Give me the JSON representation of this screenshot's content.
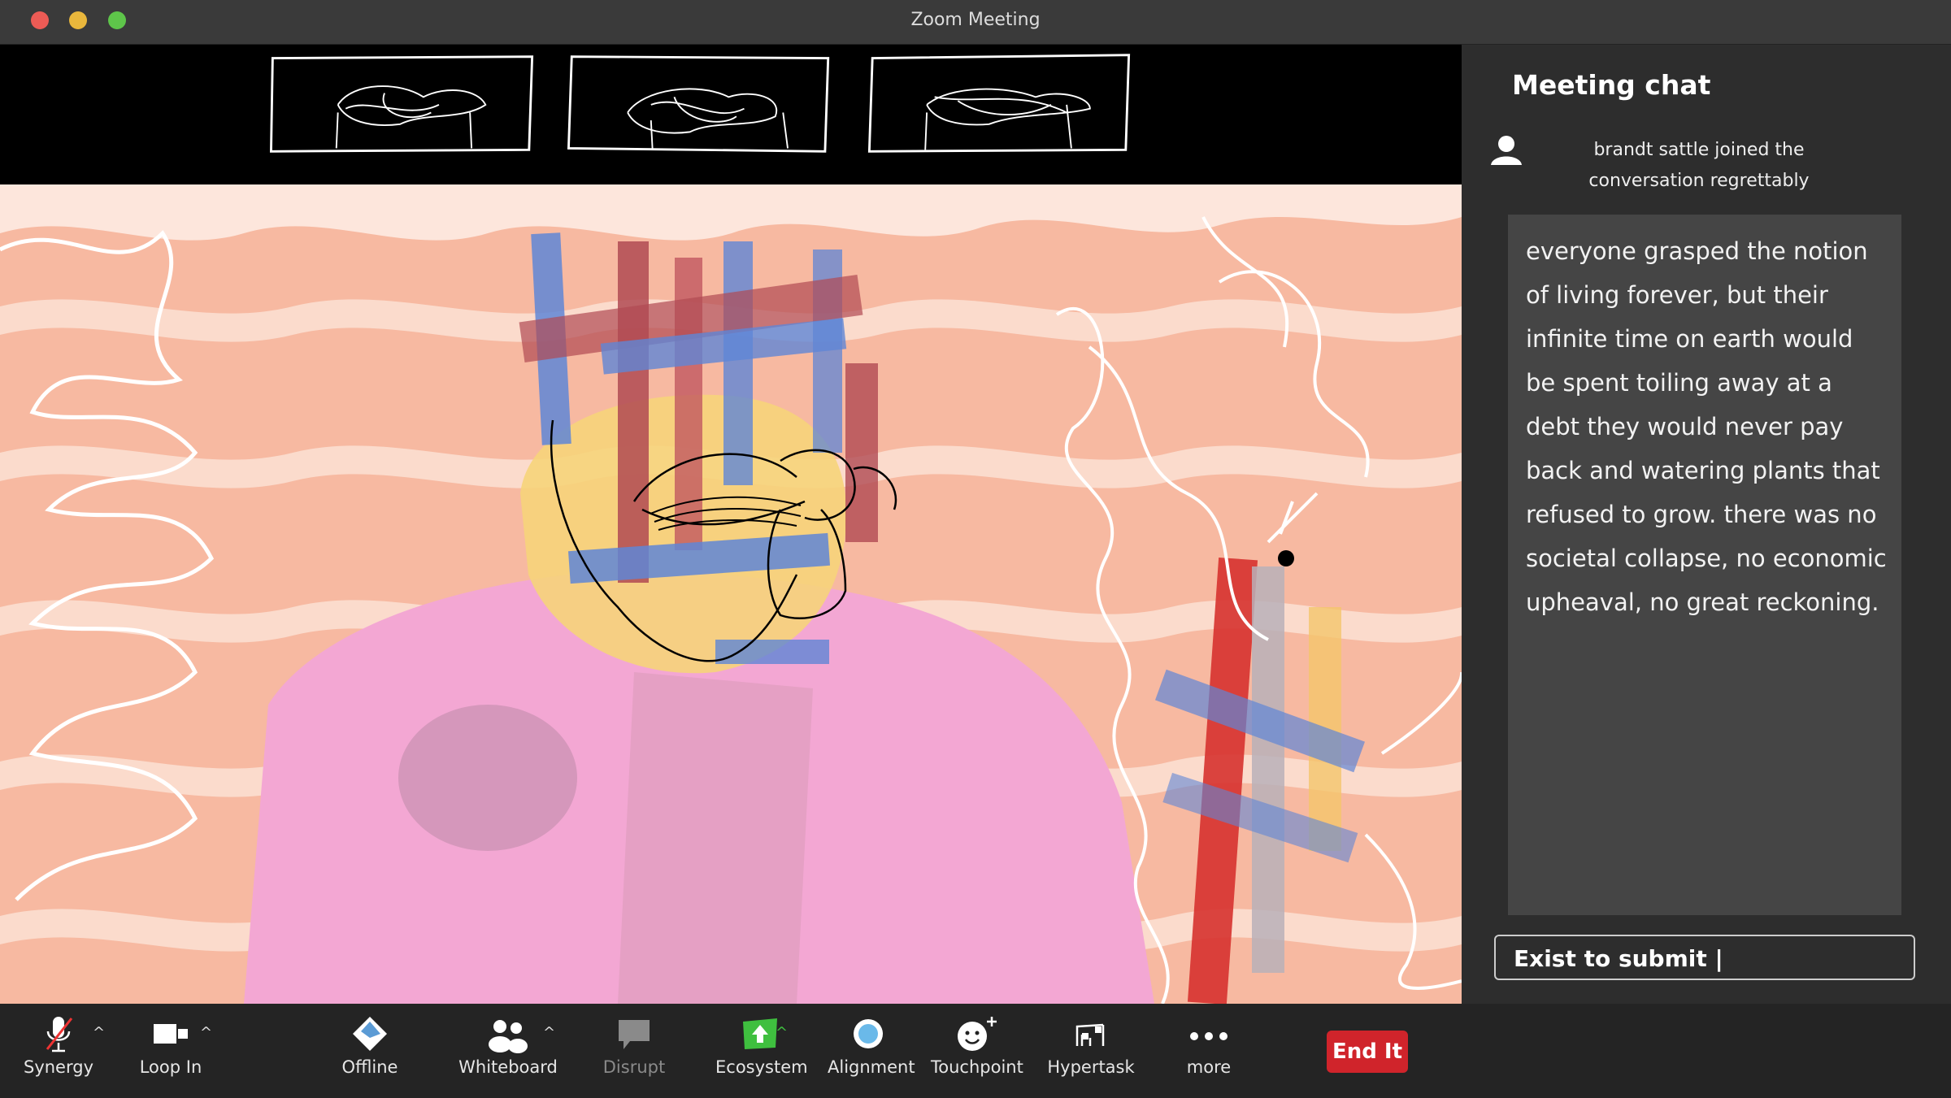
{
  "window": {
    "title": "Zoom Meeting"
  },
  "chat": {
    "title": "Meeting chat",
    "system_message": "brandt sattle joined the conversation regrettably",
    "message": "everyone grasped the notion of living forever, but their infinite time on earth would be spent toiling away at a debt they would never pay back and watering plants that refused to grow. there was no societal collapse, no economic upheaval, no great reckoning.",
    "input_value": "Exist to submit |"
  },
  "toolbar": {
    "items": [
      {
        "label": "Synergy",
        "icon": "microphone-muted-icon"
      },
      {
        "label": "Loop In",
        "icon": "video-camera-icon"
      },
      {
        "label": "Offline",
        "icon": "diamond-icon"
      },
      {
        "label": "Whiteboard",
        "icon": "participants-icon"
      },
      {
        "label": "Disrupt",
        "icon": "chat-bubble-icon"
      },
      {
        "label": "Ecosystem",
        "icon": "share-screen-icon"
      },
      {
        "label": "Alignment",
        "icon": "record-icon"
      },
      {
        "label": "Touchpoint",
        "icon": "reaction-icon"
      },
      {
        "label": "Hypertask",
        "icon": "apps-icon"
      },
      {
        "label": "more",
        "icon": "more-icon"
      }
    ],
    "end_label": "End It"
  },
  "colors": {
    "end_button": "#d0242b",
    "video_background": "#f7b9a1",
    "share_green": "#3fbf3f"
  }
}
